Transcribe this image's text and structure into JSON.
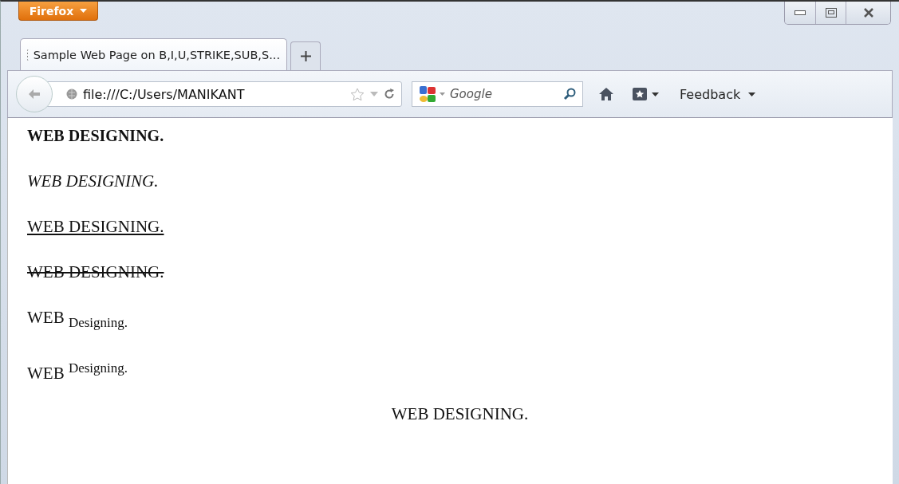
{
  "window": {
    "menu_button": "Firefox"
  },
  "tabs": [
    {
      "title": "Sample Web Page on B,I,U,STRIKE,SUB,S...",
      "selected": true
    }
  ],
  "toolbar": {
    "address": "file:///C:/Users/MANIKANT",
    "search": {
      "placeholder": "Google"
    },
    "feedback": "Feedback"
  },
  "page": {
    "lines": [
      {
        "kind": "bold",
        "text": "WEB DESIGNING."
      },
      {
        "kind": "italic",
        "text": "WEB DESIGNING."
      },
      {
        "kind": "underline",
        "text": "WEB DESIGNING."
      },
      {
        "kind": "strike",
        "text": "WEB DESIGNING."
      },
      {
        "kind": "sub",
        "text": "WEB",
        "small": "Designing."
      },
      {
        "kind": "sup",
        "text": "WEB",
        "small": "Designing."
      },
      {
        "kind": "center",
        "text": "WEB DESIGNING."
      }
    ]
  }
}
